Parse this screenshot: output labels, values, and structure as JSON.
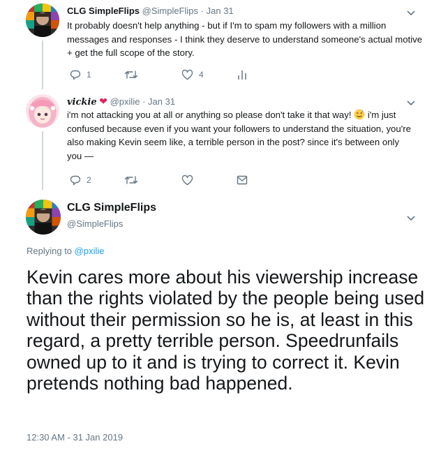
{
  "tweets": [
    {
      "fullname": "CLG SimpleFlips",
      "handle": "@SimpleFlips",
      "separator": "·",
      "date": "Jan 31",
      "text": "It probably doesn't help anything - but if I'm to spam my followers with a million messages and responses - I think they deserve to understand someone's actual motive + get the full scope of the story.",
      "replies": "1",
      "retweets": "",
      "likes": "4"
    },
    {
      "fullname": "vickie",
      "handle": "@pxilie",
      "separator": "·",
      "date": "Jan 31",
      "text_part1": "i'm not attacking you at all or anything so please don't take it that way! ",
      "text_part2": " i'm just confused because even if you want your followers to understand the situation, you're also making Kevin seem like, a terrible person in the post? since it's between only you —",
      "replies": "2",
      "retweets": "",
      "likes": ""
    }
  ],
  "main_tweet": {
    "fullname": "CLG SimpleFlips",
    "handle": "@SimpleFlips",
    "replying_prefix": "Replying to",
    "replying_to": "@pxilie",
    "text": "Kevin cares more about his viewership increase than the rights violated by the people being used without their permission so he is, at least in this regard, a pretty terrible person. Speedrunfails owned up to it and is trying to correct it. Kevin pretends nothing bad happened.",
    "timestamp": "12:30 AM - 31 Jan 2019"
  },
  "icons": {
    "reply": "reply-icon",
    "retweet": "retweet-icon",
    "like": "heart-icon",
    "analytics": "analytics-icon",
    "dm": "envelope-icon",
    "caret": "chevron-down-icon",
    "heart_badge": "heart-emoji-icon",
    "sweat_emoji": "sweat-smile-emoji-icon"
  },
  "colors": {
    "text_primary": "#14171a",
    "text_secondary": "#657786",
    "link": "#1da1f2",
    "thread_line": "#ccd6dd",
    "heart": "#e0245e"
  }
}
